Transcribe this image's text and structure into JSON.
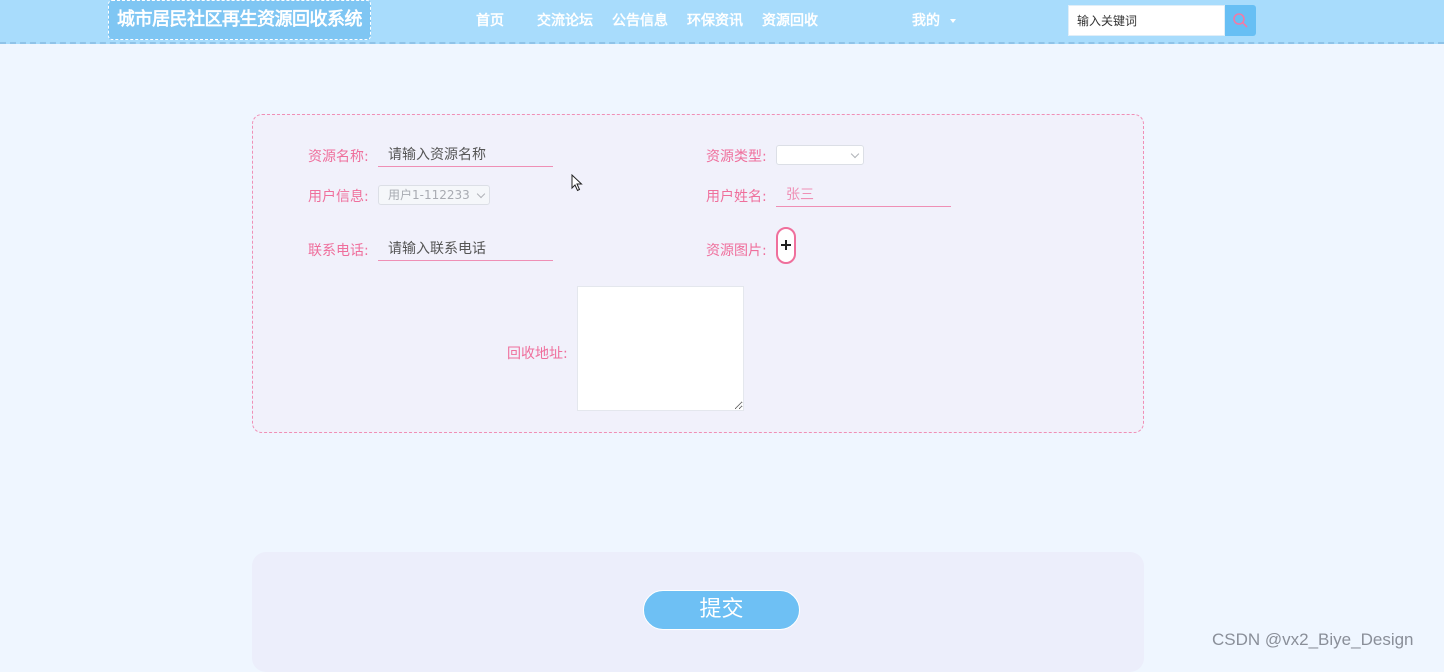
{
  "header": {
    "logo_text": "城市居民社区再生资源回收系统",
    "nav": [
      {
        "label": "首页"
      },
      {
        "label": "交流论坛"
      },
      {
        "label": "公告信息"
      },
      {
        "label": "环保资讯"
      },
      {
        "label": "资源回收"
      }
    ],
    "user_menu_label": "我的",
    "search_placeholder": "输入关键词"
  },
  "form": {
    "resource_name": {
      "label": "资源名称:",
      "placeholder": "请输入资源名称"
    },
    "resource_type": {
      "label": "资源类型:",
      "value": ""
    },
    "user_info": {
      "label": "用户信息:",
      "value": "用户1-112233"
    },
    "user_name": {
      "label": "用户姓名:",
      "value": "张三"
    },
    "phone": {
      "label": "联系电话:",
      "placeholder": "请输入联系电话"
    },
    "resource_image": {
      "label": "资源图片:"
    },
    "address": {
      "label": "回收地址:",
      "value": ""
    }
  },
  "submit_label": "提交",
  "watermark": "CSDN @vx2_Biye_Design",
  "colors": {
    "header_bg": "#a8dcfc",
    "label_pink": "#ef6f9c",
    "button_blue": "#6ec0f4",
    "page_bg": "#eff6ff"
  }
}
